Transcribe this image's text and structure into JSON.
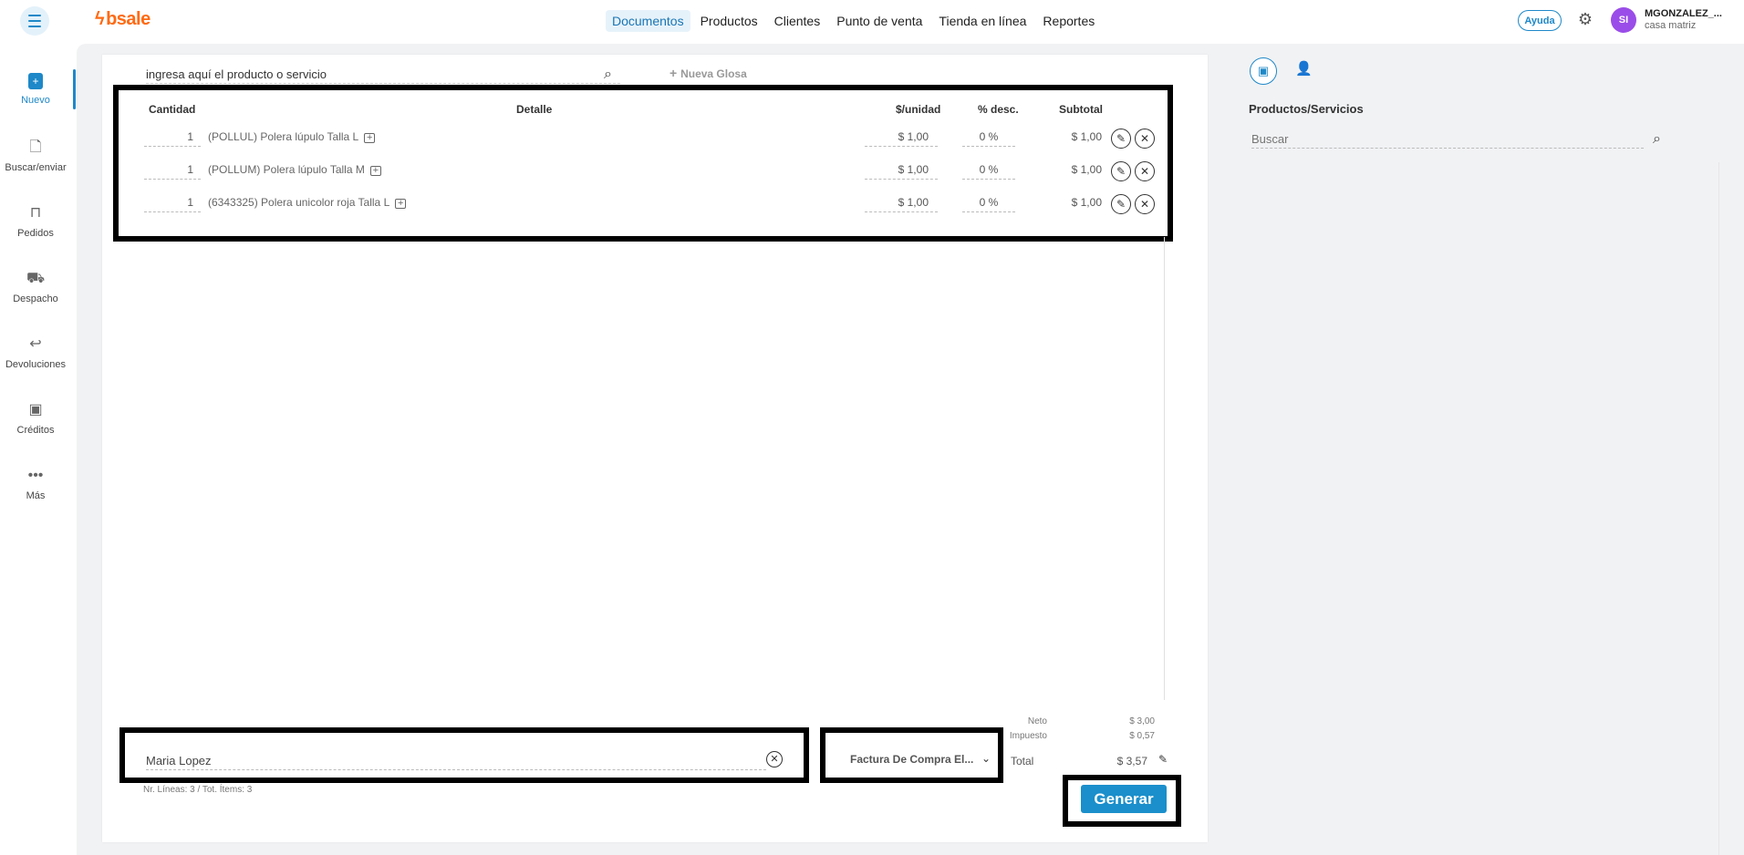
{
  "brand": {
    "logo_text": "bsale",
    "accent": "#1e88c8",
    "logo_color": "#ff6a13"
  },
  "topnav": {
    "items": [
      {
        "label": "Documentos",
        "active": true
      },
      {
        "label": "Productos"
      },
      {
        "label": "Clientes"
      },
      {
        "label": "Punto de venta"
      },
      {
        "label": "Tienda en línea"
      },
      {
        "label": "Reportes"
      }
    ],
    "help_label": "Ayuda",
    "user_initials": "SI",
    "user_name": "MGONZALEZ_...",
    "user_branch": "casa matriz"
  },
  "sidebar": {
    "items": [
      {
        "label": "Nuevo",
        "icon": "new-document-icon",
        "active": true
      },
      {
        "label": "Buscar/enviar",
        "icon": "search-document-icon"
      },
      {
        "label": "Pedidos",
        "icon": "shopping-bag-icon"
      },
      {
        "label": "Despacho",
        "icon": "truck-icon"
      },
      {
        "label": "Devoluciones",
        "icon": "return-arrow-icon"
      },
      {
        "label": "Créditos",
        "icon": "credit-icon"
      },
      {
        "label": "Más",
        "icon": "more-dots-icon"
      }
    ]
  },
  "document": {
    "search_value": "ingresa aquí el producto o servicio",
    "new_glosa_label": "Nueva Glosa",
    "columns": {
      "qty": "Cantidad",
      "detail": "Detalle",
      "unit": "$/unidad",
      "disc": "% desc.",
      "subtotal": "Subtotal"
    },
    "rows": [
      {
        "qty": "1",
        "detail": "(POLLUL) Polera lúpulo Talla L",
        "price": "$ 1,00",
        "disc": "0 %",
        "subtotal": "$ 1,00"
      },
      {
        "qty": "1",
        "detail": "(POLLUM) Polera lúpulo Talla M",
        "price": "$ 1,00",
        "disc": "0 %",
        "subtotal": "$ 1,00"
      },
      {
        "qty": "1",
        "detail": "(6343325) Polera unicolor roja Talla L",
        "price": "$ 1,00",
        "disc": "0 %",
        "subtotal": "$ 1,00"
      }
    ],
    "client_value": "Maria Lopez",
    "lines_info": "Nr. Líneas: 3 / Tot. Ítems: 3",
    "doc_type": "Factura De Compra El...",
    "totals": {
      "neto_label": "Neto",
      "neto_value": "$ 3,00",
      "impuesto_label": "Impuesto",
      "impuesto_value": "$ 0,57",
      "total_label": "Total",
      "total_value": "$ 3,57"
    },
    "generate_label": "Generar"
  },
  "right_panel": {
    "title": "Productos/Servicios",
    "search_placeholder": "Buscar"
  }
}
